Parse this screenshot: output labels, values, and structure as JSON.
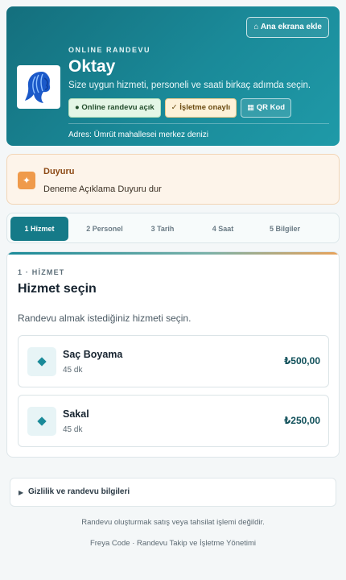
{
  "header": {
    "home_button": "⌂ Ana ekrana ekle",
    "eyebrow": "ONLINE RANDEVU",
    "business_name": "Oktay",
    "tagline": "Size uygun hizmeti, personeli ve saati birkaç adımda seçin.",
    "badges": {
      "online": "● Online randevu açık",
      "approval": "✓ İşletme onaylı",
      "qr": "▦ QR Kod"
    },
    "address": "Adres: Ümrüt mahallesei merkez denizi"
  },
  "notice": {
    "icon": "sparkle-icon",
    "title": "Duyuru",
    "text": "Deneme Açıklama Duyuru dur"
  },
  "steps": [
    {
      "label": "1 Hizmet",
      "active": true
    },
    {
      "label": "2 Personel",
      "active": false
    },
    {
      "label": "3 Tarih",
      "active": false
    },
    {
      "label": "4 Saat",
      "active": false
    },
    {
      "label": "5 Bilgiler",
      "active": false
    }
  ],
  "main": {
    "step_label": "1 · HİZMET",
    "title": "Hizmet seçin",
    "subtitle": "Randevu almak istediğiniz hizmeti seçin.",
    "services": [
      {
        "name": "Saç Boyama",
        "duration": "45 dk",
        "price": "₺500,00"
      },
      {
        "name": "Sakal",
        "duration": "45 dk",
        "price": "₺250,00"
      }
    ]
  },
  "privacy": {
    "label": "Gizlilik ve randevu bilgileri"
  },
  "footer": {
    "note": "Randevu oluşturmak satış veya tahsilat işlemi değildir.",
    "brand": "Freya Code · Randevu Takip ve İşletme Yönetimi"
  },
  "colors": {
    "brand": "#1a8a99",
    "active_step": "#157a88",
    "notice_accent": "#ef9a4b"
  }
}
